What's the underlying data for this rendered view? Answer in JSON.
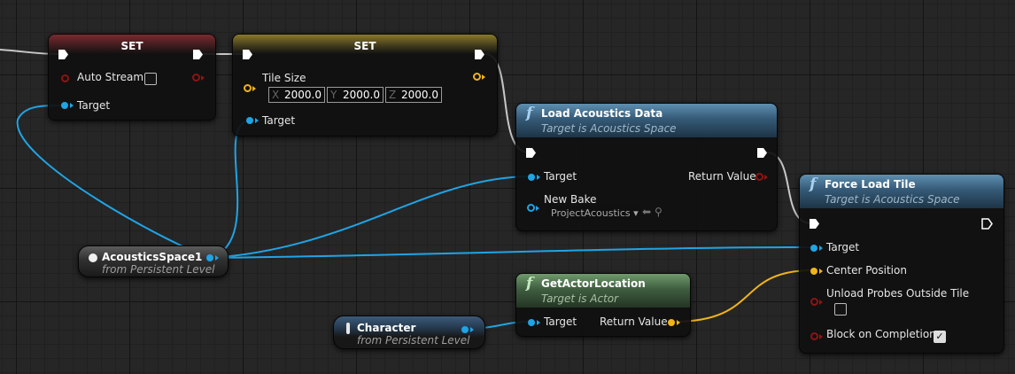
{
  "set_autostream": {
    "title": "SET",
    "param_label": "Auto Stream",
    "target_label": "Target"
  },
  "set_tilesize": {
    "title": "SET",
    "param_label": "Tile Size",
    "x_axis": "X",
    "x_value": "2000.0",
    "y_axis": "Y",
    "y_value": "2000.0",
    "z_axis": "Z",
    "z_value": "2000.0",
    "target_label": "Target"
  },
  "load_acoustics": {
    "icon": "f",
    "title": "Load Acoustics Data",
    "subtitle": "Target is Acoustics Space",
    "target_label": "Target",
    "return_label": "Return Value",
    "new_bake_label": "New Bake",
    "new_bake_value": "ProjectAcoustics"
  },
  "force_load_tile": {
    "icon": "f",
    "title": "Force Load Tile",
    "subtitle": "Target is Acoustics Space",
    "target_label": "Target",
    "center_label": "Center Position",
    "unload_label": "Unload Probes Outside Tile",
    "block_label": "Block on Completion",
    "block_checked": true
  },
  "get_actor_location": {
    "icon": "f",
    "title": "GetActorLocation",
    "subtitle": "Target is Actor",
    "target_label": "Target",
    "return_label": "Return Value"
  },
  "acoustics_space_var": {
    "title": "AcousticsSpace1",
    "subtitle": "from Persistent Level"
  },
  "character_var": {
    "title": "Character",
    "subtitle": "from Persistent Level"
  },
  "colors": {
    "exec_wire": "#c8c8c8",
    "object_pin": "#1fa4e6",
    "vector_pin": "#f0b417",
    "bool_pin": "#8e1412",
    "function_header": "#355a77",
    "pure_header": "#3f5e40"
  }
}
